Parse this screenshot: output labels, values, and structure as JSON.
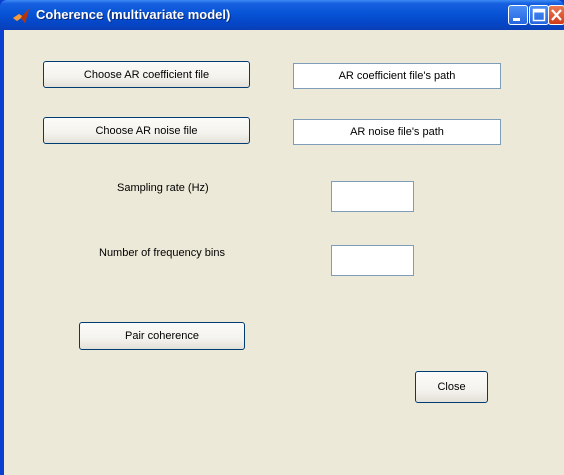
{
  "window": {
    "title": "Coherence (multivariate model)"
  },
  "buttons": {
    "choose_ar_coefficient": "Choose AR coefficient file",
    "choose_ar_noise": "Choose AR noise file",
    "pair_coherence": "Pair coherence",
    "close": "Close"
  },
  "fields": {
    "ar_coefficient_path": "AR coefficient file's path",
    "ar_noise_path": "AR noise file's path",
    "sampling_rate_value": "",
    "frequency_bins_value": ""
  },
  "labels": {
    "sampling_rate": "Sampling rate (Hz)",
    "frequency_bins": "Number of frequency bins"
  },
  "icons": {
    "app": "matlab-icon",
    "minimize": "minimize-icon",
    "maximize": "maximize-icon",
    "close": "close-icon"
  }
}
